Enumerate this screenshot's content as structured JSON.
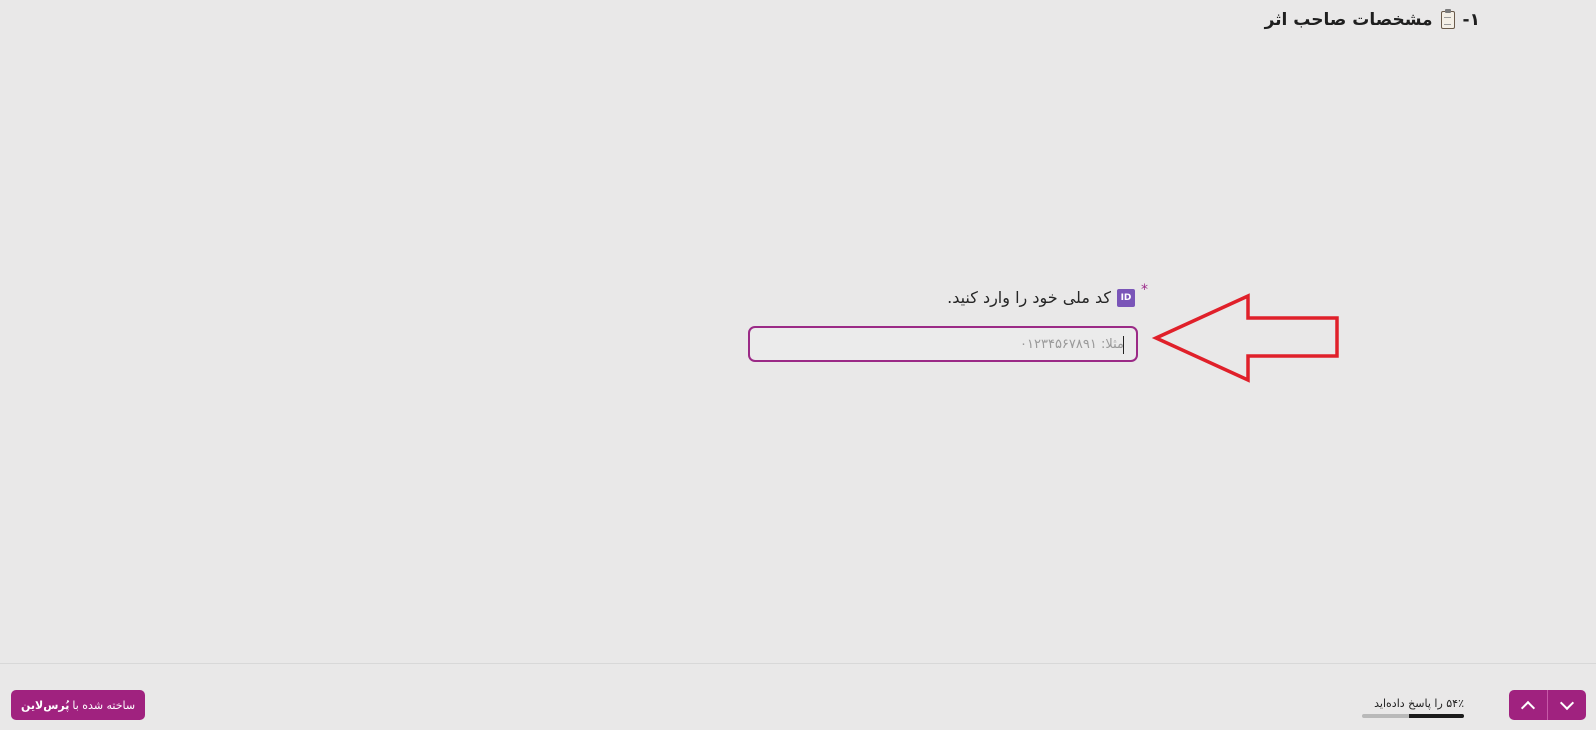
{
  "section": {
    "number": "۱-",
    "icon": "clipboard-icon",
    "title": "مشخصات صاحب اثر"
  },
  "question": {
    "required_mark": "*",
    "icon": "id-icon",
    "icon_text": "ID",
    "label": "کد ملی خود را وارد کنید."
  },
  "national_code_input": {
    "value": "",
    "placeholder": "مثلا: ۰۱۲۳۴۵۶۷۸۹۱"
  },
  "annotation": {
    "arrow_color": "#e0202a",
    "direction": "pointing-left"
  },
  "footer": {
    "brand_prefix": "ساخته شده با",
    "brand_name": "پُرس‌لاین",
    "progress_text": "۵۴٪ را پاسخ داده‌اید",
    "progress_fraction": 0.54,
    "nav_up_icon": "chevron-up-icon",
    "nav_down_icon": "chevron-down-icon"
  },
  "colors": {
    "accent": "#a0227f",
    "background": "#e9e8e8",
    "input_border": "#9b2a86"
  }
}
